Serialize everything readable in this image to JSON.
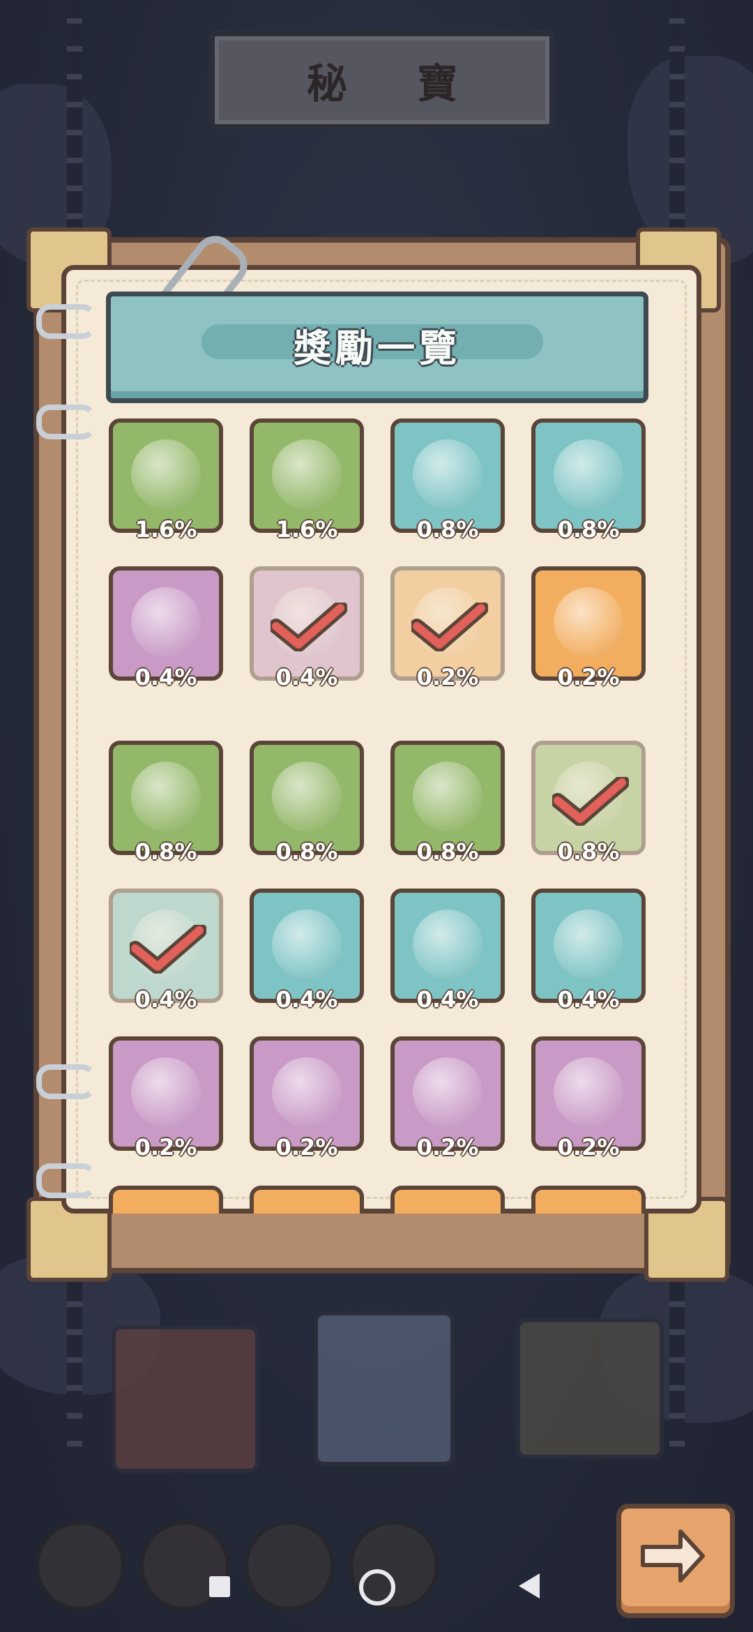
{
  "header": {
    "title": "秘 寶"
  },
  "panel": {
    "title": "獎勵一覽"
  },
  "rewards": [
    {
      "rate": "1.6%",
      "color": "green",
      "icon": "armor-icon",
      "collected": false
    },
    {
      "rate": "1.6%",
      "color": "green",
      "icon": "collar-icon",
      "collected": false
    },
    {
      "rate": "0.8%",
      "color": "teal",
      "icon": "hook-icon",
      "collected": false
    },
    {
      "rate": "0.8%",
      "color": "teal",
      "icon": "tooth-necklace-icon",
      "collected": false
    },
    {
      "rate": "0.4%",
      "color": "pink",
      "icon": "crown-icon",
      "collected": false
    },
    {
      "rate": "0.4%",
      "color": "pink",
      "icon": "statue-icon",
      "collected": true
    },
    {
      "rate": "0.2%",
      "color": "orange",
      "icon": "fish-bone-icon",
      "collected": true
    },
    {
      "rate": "0.2%",
      "color": "orange",
      "icon": "robot-armor-icon",
      "collected": false
    },
    {
      "rate": "0.8%",
      "color": "green",
      "icon": "rock-bundle-icon",
      "collected": false
    },
    {
      "rate": "0.8%",
      "color": "green",
      "icon": "spiral-cat-icon",
      "collected": false
    },
    {
      "rate": "0.8%",
      "color": "green",
      "icon": "sleeping-cat-icon",
      "collected": false
    },
    {
      "rate": "0.8%",
      "color": "green",
      "icon": "sprout-box-icon",
      "collected": true
    },
    {
      "rate": "0.4%",
      "color": "teal",
      "icon": "egg-icon",
      "collected": true
    },
    {
      "rate": "0.4%",
      "color": "teal",
      "icon": "scarf-icon",
      "collected": false
    },
    {
      "rate": "0.4%",
      "color": "teal",
      "icon": "rose-icon",
      "collected": false
    },
    {
      "rate": "0.4%",
      "color": "teal",
      "icon": "celestial-globe-icon",
      "collected": false
    },
    {
      "rate": "0.2%",
      "color": "pink",
      "icon": "skull-icon",
      "collected": false
    },
    {
      "rate": "0.2%",
      "color": "pink",
      "icon": "rainbow-ball-icon",
      "collected": false
    },
    {
      "rate": "0.2%",
      "color": "pink",
      "icon": "teapot-icon",
      "collected": false
    },
    {
      "rate": "0.2%",
      "color": "pink",
      "icon": "lion-statue-icon",
      "collected": false
    }
  ],
  "colors": {
    "green": "#94b86a",
    "teal": "#7fc4c4",
    "pink": "#c99ac6",
    "orange": "#f3ad5e",
    "frame": "#5a4538",
    "check": "#e2615a"
  }
}
